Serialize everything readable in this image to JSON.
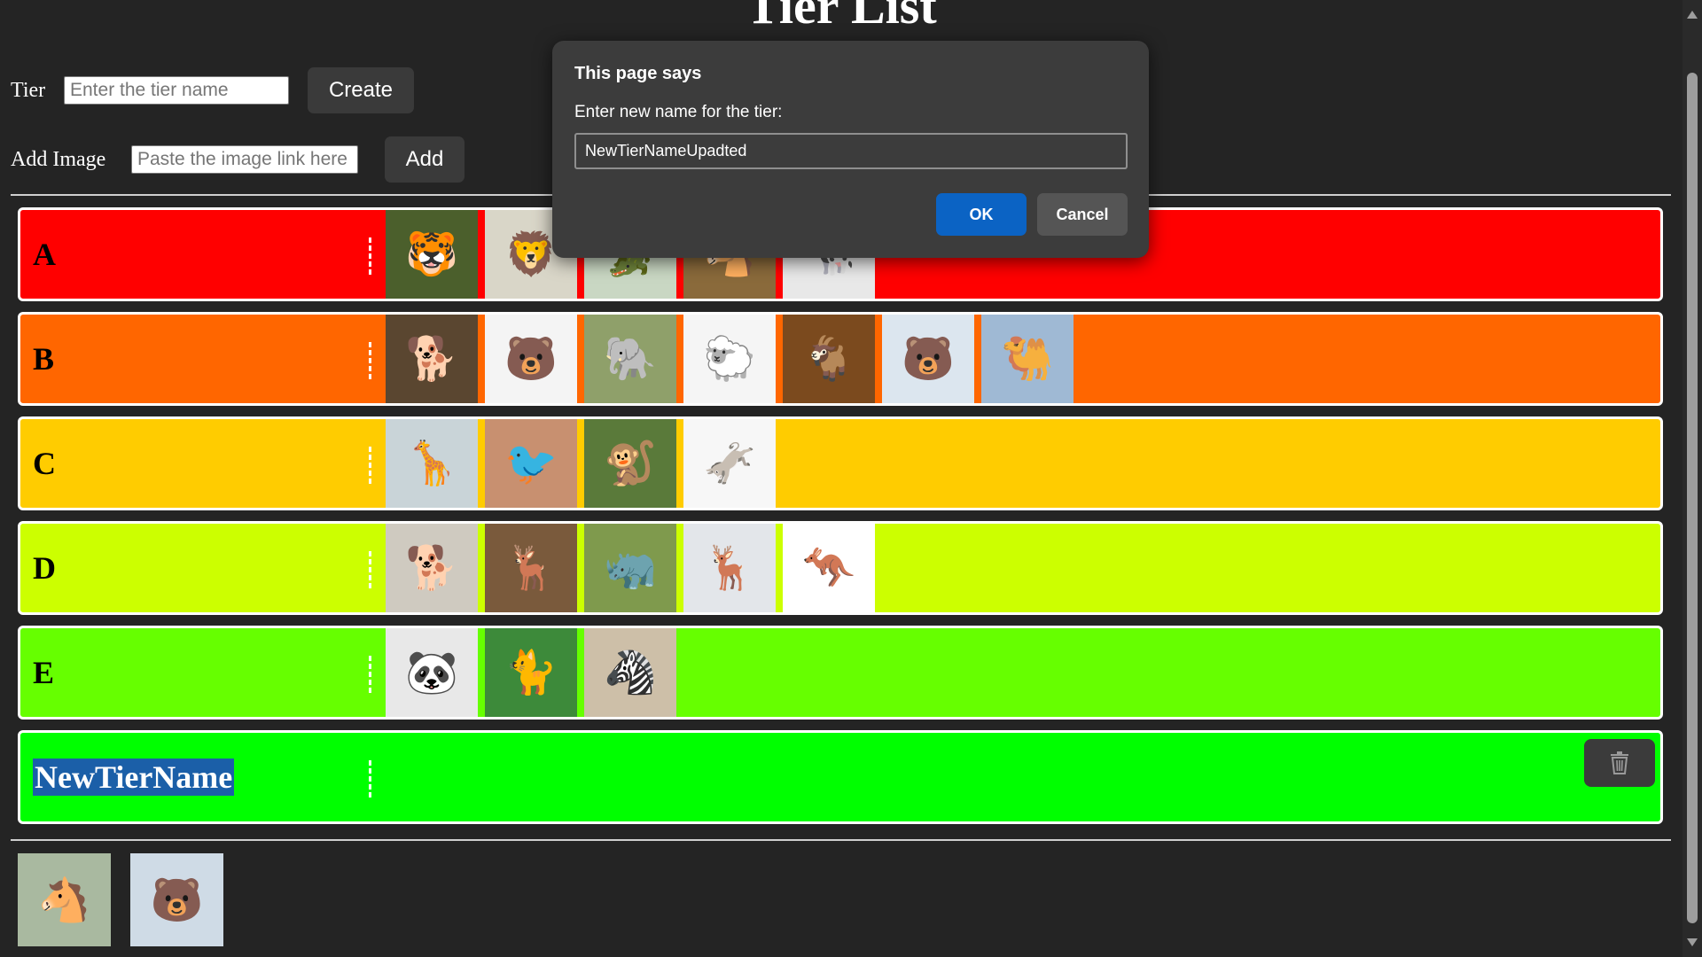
{
  "page": {
    "title": "Tier List"
  },
  "form": {
    "tier_label": "Tier",
    "tier_placeholder": "Enter the tier name",
    "create_label": "Create",
    "image_label": "Add Image",
    "image_placeholder": "Paste the image link here",
    "add_label": "Add"
  },
  "tiers": [
    {
      "label": "A",
      "color": "#ff0000",
      "images": [
        {
          "name": "tiger",
          "bg": "#4b5f2c",
          "glyph": "🐯"
        },
        {
          "name": "lion",
          "bg": "#d9d6c8",
          "glyph": "🦁"
        },
        {
          "name": "crocodile",
          "bg": "#c9d7c3",
          "glyph": "🐊"
        },
        {
          "name": "horse",
          "bg": "#8a6a3b",
          "glyph": "🐴"
        },
        {
          "name": "cow",
          "bg": "#e8e8e8",
          "glyph": "🐄"
        }
      ]
    },
    {
      "label": "B",
      "color": "#ff6600",
      "images": [
        {
          "name": "dog",
          "bg": "#5a4630",
          "glyph": "🐕"
        },
        {
          "name": "bear",
          "bg": "#f4f4f4",
          "glyph": "🐻"
        },
        {
          "name": "elephant",
          "bg": "#8fa06a",
          "glyph": "🐘"
        },
        {
          "name": "sheep",
          "bg": "#f5f5f5",
          "glyph": "🐑"
        },
        {
          "name": "goat",
          "bg": "#7b4a1e",
          "glyph": "🐐"
        },
        {
          "name": "polar-bear",
          "bg": "#dce6ef",
          "glyph": "🐻"
        },
        {
          "name": "camel",
          "bg": "#9fb9d4",
          "glyph": "🐫"
        }
      ]
    },
    {
      "label": "C",
      "color": "#ffcc00",
      "images": [
        {
          "name": "giraffe",
          "bg": "#c9d4d8",
          "glyph": "🦒"
        },
        {
          "name": "bird",
          "bg": "#c89070",
          "glyph": "🐦"
        },
        {
          "name": "chimpanzee",
          "bg": "#5a7a3a",
          "glyph": "🐒"
        },
        {
          "name": "donkey",
          "bg": "#f7f7f7",
          "glyph": "🫏"
        }
      ]
    },
    {
      "label": "D",
      "color": "#ccff00",
      "images": [
        {
          "name": "hyena",
          "bg": "#cfcac0",
          "glyph": "🐕"
        },
        {
          "name": "deer",
          "bg": "#7a5a3c",
          "glyph": "🦌"
        },
        {
          "name": "rhinoceros",
          "bg": "#7f9a4d",
          "glyph": "🦏"
        },
        {
          "name": "reindeer",
          "bg": "#e3e6ea",
          "glyph": "🦌"
        },
        {
          "name": "kangaroo",
          "bg": "#ffffff",
          "glyph": "🦘"
        }
      ]
    },
    {
      "label": "E",
      "color": "#66ff00",
      "images": [
        {
          "name": "panda",
          "bg": "#e8e8e8",
          "glyph": "🐼"
        },
        {
          "name": "cat",
          "bg": "#3d8a3a",
          "glyph": "🐈"
        },
        {
          "name": "zebra",
          "bg": "#cdbfa8",
          "glyph": "🦓"
        }
      ]
    },
    {
      "label": "NewTierName",
      "color": "#00ff00",
      "images": []
    }
  ],
  "pool": [
    {
      "name": "horse",
      "bg": "#a9b9a0",
      "glyph": "🐴"
    },
    {
      "name": "polar-bear",
      "bg": "#cfdbe6",
      "glyph": "🐻"
    }
  ],
  "dialog": {
    "title": "This page says",
    "message": "Enter new name for the tier:",
    "value": "NewTierNameUpadted",
    "ok_label": "OK",
    "cancel_label": "Cancel"
  }
}
